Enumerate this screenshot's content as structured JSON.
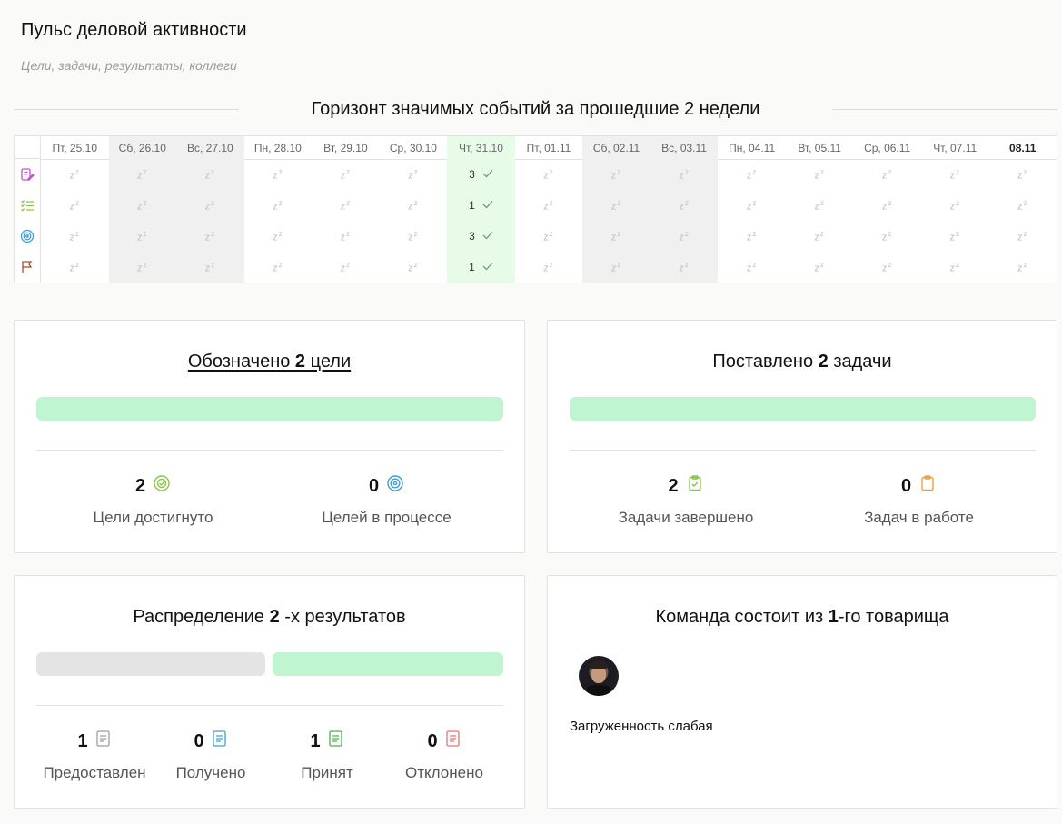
{
  "header": {
    "title": "Пульс деловой активности",
    "subtitle": "Цели, задачи, результаты, коллеги"
  },
  "timeline": {
    "title": "Горизонт значимых событий за прошедшие 2 недели",
    "row_icons": [
      "edit-note-icon",
      "checklist-icon",
      "target-icon",
      "flag-icon"
    ],
    "idle_glyph": "z",
    "days": [
      {
        "label": "Пт, 25.10",
        "type": "workday",
        "values": [
          "",
          "",
          "",
          ""
        ]
      },
      {
        "label": "Сб, 26.10",
        "type": "weekend",
        "values": [
          "",
          "",
          "",
          ""
        ]
      },
      {
        "label": "Вс, 27.10",
        "type": "weekend",
        "values": [
          "",
          "",
          "",
          ""
        ]
      },
      {
        "label": "Пн, 28.10",
        "type": "workday",
        "values": [
          "",
          "",
          "",
          ""
        ]
      },
      {
        "label": "Вт, 29.10",
        "type": "workday",
        "values": [
          "",
          "",
          "",
          ""
        ]
      },
      {
        "label": "Ср, 30.10",
        "type": "workday",
        "values": [
          "",
          "",
          "",
          ""
        ]
      },
      {
        "label": "Чт, 31.10",
        "type": "active",
        "values": [
          "3",
          "1",
          "3",
          "1"
        ]
      },
      {
        "label": "Пт, 01.11",
        "type": "workday",
        "values": [
          "",
          "",
          "",
          ""
        ]
      },
      {
        "label": "Сб, 02.11",
        "type": "weekend",
        "values": [
          "",
          "",
          "",
          ""
        ]
      },
      {
        "label": "Вс, 03.11",
        "type": "weekend",
        "values": [
          "",
          "",
          "",
          ""
        ]
      },
      {
        "label": "Пн, 04.11",
        "type": "workday",
        "values": [
          "",
          "",
          "",
          ""
        ]
      },
      {
        "label": "Вт, 05.11",
        "type": "workday",
        "values": [
          "",
          "",
          "",
          ""
        ]
      },
      {
        "label": "Ср, 06.11",
        "type": "workday",
        "values": [
          "",
          "",
          "",
          ""
        ]
      },
      {
        "label": "Чт, 07.11",
        "type": "workday",
        "values": [
          "",
          "",
          "",
          ""
        ]
      },
      {
        "label": "08.11",
        "type": "today",
        "values": [
          "",
          "",
          "",
          ""
        ]
      }
    ]
  },
  "goals_card": {
    "title_pre": "Обозначено ",
    "title_num": "2",
    "title_post": " цели",
    "progress_fraction": 1.0,
    "stats": [
      {
        "value": "2",
        "label": "Цели достигнуто",
        "icon": "target-check-icon",
        "color": "#8bc34a"
      },
      {
        "value": "0",
        "label": "Целей в процессе",
        "icon": "target-icon",
        "color": "#3aa0d8"
      }
    ]
  },
  "tasks_card": {
    "title_pre": "Поставлено ",
    "title_num": "2",
    "title_post": " задачи",
    "progress_fraction": 1.0,
    "stats": [
      {
        "value": "2",
        "label": "Задачи завершено",
        "icon": "clipboard-check-icon",
        "color": "#8bc34a"
      },
      {
        "value": "0",
        "label": "Задач в работе",
        "icon": "clipboard-icon",
        "color": "#f0a040"
      }
    ]
  },
  "results_card": {
    "title_pre": "Распределение ",
    "title_num": "2",
    "title_post": " -х результатов",
    "bar_split": [
      0.5,
      0.5
    ],
    "stats": [
      {
        "value": "1",
        "label": "Предоставлен",
        "icon": "document-icon",
        "color": "#9e9e9e"
      },
      {
        "value": "0",
        "label": "Получено",
        "icon": "document-icon",
        "color": "#3aa0d8"
      },
      {
        "value": "1",
        "label": "Принят",
        "icon": "document-icon",
        "color": "#4caf50"
      },
      {
        "value": "0",
        "label": "Отклонено",
        "icon": "document-icon",
        "color": "#e57373"
      }
    ]
  },
  "team_card": {
    "title_pre": "Команда состоит из ",
    "title_num": "1",
    "title_post": "-го товарища",
    "workload": "Загруженность слабая"
  },
  "colors": {
    "accent_green": "#bff5d0",
    "active_day": "#e8fbe9",
    "weekend": "#f0f0f0"
  }
}
